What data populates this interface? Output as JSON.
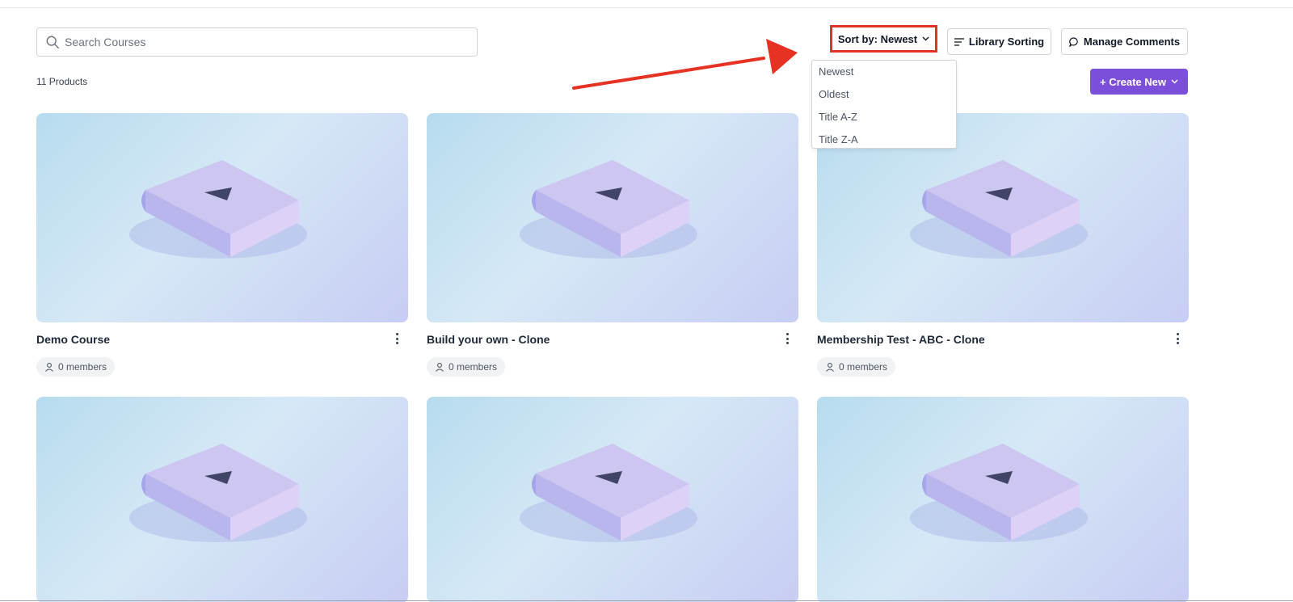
{
  "search": {
    "placeholder": "Search Courses"
  },
  "toolbar": {
    "sort_label": "Sort by: Newest",
    "library_sorting_label": "Library Sorting",
    "manage_comments_label": "Manage Comments",
    "create_new_label": "+ Create New"
  },
  "products_count": "11 Products",
  "sort_options": [
    "Newest",
    "Oldest",
    "Title A-Z",
    "Title Z-A"
  ],
  "courses": [
    {
      "title": "Demo Course",
      "members": "0 members"
    },
    {
      "title": "Build your own - Clone",
      "members": "0 members"
    },
    {
      "title": "Membership Test - ABC - Clone",
      "members": "0 members"
    }
  ],
  "colors": {
    "accent": "#7b4fd9",
    "highlight": "#e53222"
  }
}
